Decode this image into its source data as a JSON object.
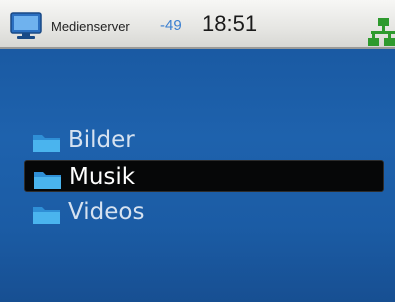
{
  "status_bar": {
    "server_name": "Medienserver",
    "signal": "-49",
    "time": "18:51",
    "icons": {
      "left": "monitor-icon",
      "right": "network-icon"
    }
  },
  "menu": {
    "items": [
      {
        "label": "Bilder",
        "icon": "folder-icon",
        "selected": false
      },
      {
        "label": "Musik",
        "icon": "folder-icon",
        "selected": true
      },
      {
        "label": "Videos",
        "icon": "folder-icon",
        "selected": false
      }
    ]
  },
  "colors": {
    "background": "#1f5fa6",
    "selection": "#060708",
    "folder": "#3aa6e8",
    "network": "#2e9a2e",
    "signal_text": "#3a7fd0"
  }
}
